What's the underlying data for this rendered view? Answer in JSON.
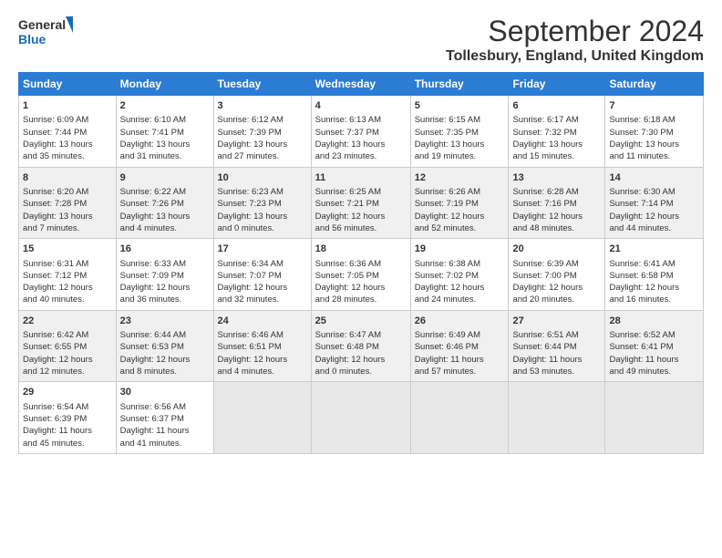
{
  "header": {
    "logo_line1": "General",
    "logo_line2": "Blue",
    "main_title": "September 2024",
    "subtitle": "Tollesbury, England, United Kingdom"
  },
  "calendar": {
    "headers": [
      "Sunday",
      "Monday",
      "Tuesday",
      "Wednesday",
      "Thursday",
      "Friday",
      "Saturday"
    ],
    "weeks": [
      [
        {
          "day": "",
          "empty": true
        },
        {
          "day": "",
          "empty": true
        },
        {
          "day": "",
          "empty": true
        },
        {
          "day": "",
          "empty": true
        },
        {
          "day": "",
          "empty": true
        },
        {
          "day": "",
          "empty": true
        },
        {
          "day": "7",
          "rise": "6:18 AM",
          "set": "7:30 PM",
          "daylight": "13 hours and 11 minutes."
        }
      ],
      [
        {
          "day": "1",
          "rise": "6:09 AM",
          "set": "7:44 PM",
          "daylight": "13 hours and 35 minutes."
        },
        {
          "day": "2",
          "rise": "6:10 AM",
          "set": "7:41 PM",
          "daylight": "13 hours and 31 minutes."
        },
        {
          "day": "3",
          "rise": "6:12 AM",
          "set": "7:39 PM",
          "daylight": "13 hours and 27 minutes."
        },
        {
          "day": "4",
          "rise": "6:13 AM",
          "set": "7:37 PM",
          "daylight": "13 hours and 23 minutes."
        },
        {
          "day": "5",
          "rise": "6:15 AM",
          "set": "7:35 PM",
          "daylight": "13 hours and 19 minutes."
        },
        {
          "day": "6",
          "rise": "6:17 AM",
          "set": "7:32 PM",
          "daylight": "13 hours and 15 minutes."
        },
        {
          "day": "7",
          "rise": "6:18 AM",
          "set": "7:30 PM",
          "daylight": "13 hours and 11 minutes."
        }
      ],
      [
        {
          "day": "8",
          "rise": "6:20 AM",
          "set": "7:28 PM",
          "daylight": "13 hours and 7 minutes."
        },
        {
          "day": "9",
          "rise": "6:22 AM",
          "set": "7:26 PM",
          "daylight": "13 hours and 4 minutes."
        },
        {
          "day": "10",
          "rise": "6:23 AM",
          "set": "7:23 PM",
          "daylight": "13 hours and 0 minutes."
        },
        {
          "day": "11",
          "rise": "6:25 AM",
          "set": "7:21 PM",
          "daylight": "12 hours and 56 minutes."
        },
        {
          "day": "12",
          "rise": "6:26 AM",
          "set": "7:19 PM",
          "daylight": "12 hours and 52 minutes."
        },
        {
          "day": "13",
          "rise": "6:28 AM",
          "set": "7:16 PM",
          "daylight": "12 hours and 48 minutes."
        },
        {
          "day": "14",
          "rise": "6:30 AM",
          "set": "7:14 PM",
          "daylight": "12 hours and 44 minutes."
        }
      ],
      [
        {
          "day": "15",
          "rise": "6:31 AM",
          "set": "7:12 PM",
          "daylight": "12 hours and 40 minutes."
        },
        {
          "day": "16",
          "rise": "6:33 AM",
          "set": "7:09 PM",
          "daylight": "12 hours and 36 minutes."
        },
        {
          "day": "17",
          "rise": "6:34 AM",
          "set": "7:07 PM",
          "daylight": "12 hours and 32 minutes."
        },
        {
          "day": "18",
          "rise": "6:36 AM",
          "set": "7:05 PM",
          "daylight": "12 hours and 28 minutes."
        },
        {
          "day": "19",
          "rise": "6:38 AM",
          "set": "7:02 PM",
          "daylight": "12 hours and 24 minutes."
        },
        {
          "day": "20",
          "rise": "6:39 AM",
          "set": "7:00 PM",
          "daylight": "12 hours and 20 minutes."
        },
        {
          "day": "21",
          "rise": "6:41 AM",
          "set": "6:58 PM",
          "daylight": "12 hours and 16 minutes."
        }
      ],
      [
        {
          "day": "22",
          "rise": "6:42 AM",
          "set": "6:55 PM",
          "daylight": "12 hours and 12 minutes."
        },
        {
          "day": "23",
          "rise": "6:44 AM",
          "set": "6:53 PM",
          "daylight": "12 hours and 8 minutes."
        },
        {
          "day": "24",
          "rise": "6:46 AM",
          "set": "6:51 PM",
          "daylight": "12 hours and 4 minutes."
        },
        {
          "day": "25",
          "rise": "6:47 AM",
          "set": "6:48 PM",
          "daylight": "12 hours and 0 minutes."
        },
        {
          "day": "26",
          "rise": "6:49 AM",
          "set": "6:46 PM",
          "daylight": "11 hours and 57 minutes."
        },
        {
          "day": "27",
          "rise": "6:51 AM",
          "set": "6:44 PM",
          "daylight": "11 hours and 53 minutes."
        },
        {
          "day": "28",
          "rise": "6:52 AM",
          "set": "6:41 PM",
          "daylight": "11 hours and 49 minutes."
        }
      ],
      [
        {
          "day": "29",
          "rise": "6:54 AM",
          "set": "6:39 PM",
          "daylight": "11 hours and 45 minutes."
        },
        {
          "day": "30",
          "rise": "6:56 AM",
          "set": "6:37 PM",
          "daylight": "11 hours and 41 minutes."
        },
        {
          "day": "",
          "empty": true
        },
        {
          "day": "",
          "empty": true
        },
        {
          "day": "",
          "empty": true
        },
        {
          "day": "",
          "empty": true
        },
        {
          "day": "",
          "empty": true
        }
      ]
    ]
  }
}
